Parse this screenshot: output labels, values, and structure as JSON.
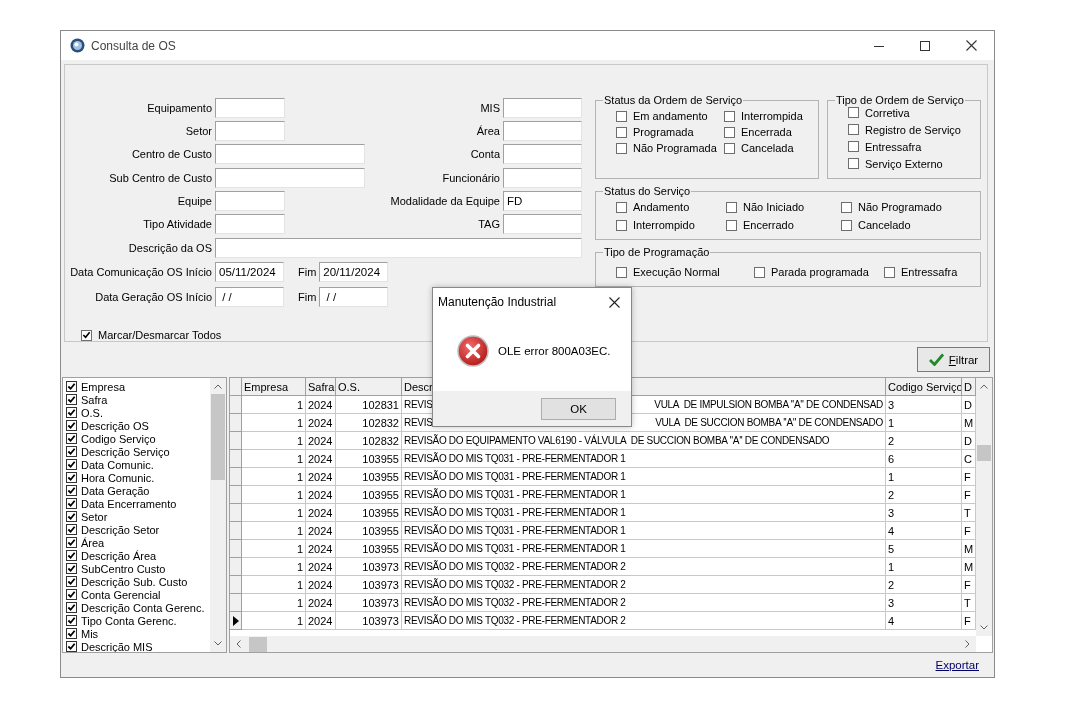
{
  "window": {
    "title": "Consulta de OS"
  },
  "form": {
    "rows": [
      {
        "left": {
          "label": "Equipamento"
        },
        "right": {
          "label": "MIS"
        }
      },
      {
        "left": {
          "label": "Setor"
        },
        "right": {
          "label": "Área"
        }
      },
      {
        "left": {
          "label": "Centro de Custo"
        },
        "right": {
          "label": "Conta"
        }
      },
      {
        "left": {
          "label": "Sub Centro de Custo"
        },
        "right": {
          "label": "Funcionário"
        }
      },
      {
        "left": {
          "label": "Equipe"
        },
        "right": {
          "label": "Modalidade da Equipe",
          "value": "FD"
        }
      },
      {
        "left": {
          "label": "Tipo Atividade"
        },
        "right": {
          "label": "TAG"
        }
      }
    ],
    "description": {
      "label": "Descrição da OS"
    },
    "date_ranges": [
      {
        "label": "Data Comunicação OS Início",
        "start": "05/11/2024",
        "end_label": "Fim",
        "end": "20/11/2024"
      },
      {
        "label": "Data Geração OS Início",
        "start": " / /",
        "end_label": "Fim",
        "end": " / /"
      }
    ],
    "toggle_all": {
      "label": "Marcar/Desmarcar Todos",
      "checked": true
    }
  },
  "groups": [
    {
      "title": "Status da Ordem de Serviço",
      "options": [
        {
          "label": "Em andamento",
          "checked": false
        },
        {
          "label": "Programada",
          "checked": false
        },
        {
          "label": "Não Programada",
          "checked": false
        },
        {
          "label": "Interrompida",
          "checked": false
        },
        {
          "label": "Encerrada",
          "checked": false
        },
        {
          "label": "Cancelada",
          "checked": false
        }
      ]
    },
    {
      "title": "Tipo de Ordem de Serviço",
      "options": [
        {
          "label": "Corretiva",
          "checked": false
        },
        {
          "label": "Registro de Serviço",
          "checked": false
        },
        {
          "label": "Entressafra",
          "checked": false
        },
        {
          "label": "Serviço Externo",
          "checked": false
        }
      ]
    },
    {
      "title": "Status do Serviço",
      "options": [
        {
          "label": "Andamento",
          "checked": false
        },
        {
          "label": "Não Iniciado",
          "checked": false
        },
        {
          "label": "Não Programado",
          "checked": false
        },
        {
          "label": "Interrompido",
          "checked": false
        },
        {
          "label": "Encerrado",
          "checked": false
        },
        {
          "label": "Cancelado",
          "checked": false
        }
      ]
    },
    {
      "title": "Tipo de Programação",
      "options": [
        {
          "label": "Execução Normal",
          "checked": false
        },
        {
          "label": "Parada programada",
          "checked": false
        },
        {
          "label": "Entressafra",
          "checked": false
        }
      ]
    }
  ],
  "filter_button": {
    "label": "Filtrar"
  },
  "column_list": {
    "items": [
      {
        "label": "Empresa",
        "checked": true
      },
      {
        "label": "Safra",
        "checked": true
      },
      {
        "label": "O.S.",
        "checked": true
      },
      {
        "label": "Descrição OS",
        "checked": true
      },
      {
        "label": "Codigo Serviço",
        "checked": true
      },
      {
        "label": "Descrição Serviço",
        "checked": true
      },
      {
        "label": "Data Comunic.",
        "checked": true
      },
      {
        "label": "Hora Comunic.",
        "checked": true
      },
      {
        "label": "Data Geração",
        "checked": true
      },
      {
        "label": "Data Encerramento",
        "checked": true
      },
      {
        "label": "Setor",
        "checked": true
      },
      {
        "label": "Descrição Setor",
        "checked": true
      },
      {
        "label": "Área",
        "checked": true
      },
      {
        "label": "Descrição Área",
        "checked": true
      },
      {
        "label": "SubCentro Custo",
        "checked": true
      },
      {
        "label": "Descrição Sub. Custo",
        "checked": true
      },
      {
        "label": "Conta Gerencial",
        "checked": true
      },
      {
        "label": "Descrição Conta Gerenc.",
        "checked": true
      },
      {
        "label": "Tipo Conta Gerenc.",
        "checked": true
      },
      {
        "label": "Mis",
        "checked": true
      },
      {
        "label": "Descrição MIS",
        "checked": true
      }
    ]
  },
  "grid": {
    "columns": [
      "Empresa",
      "Safra",
      "O.S.",
      "Descr",
      "Codigo Serviço",
      "D"
    ],
    "rows": [
      {
        "selected": false,
        "cells": [
          "1",
          "2024",
          "102831",
          [
            "REVIS",
            "VULA  DE IMPULSION BOMBA ''A'' DE CONDENSAD"
          ],
          "3",
          "D"
        ]
      },
      {
        "selected": false,
        "cells": [
          "1",
          "2024",
          "102832",
          [
            "REVIS",
            "VULA  DE SUCCION BOMBA ''A'' DE CONDENSADO"
          ],
          "1",
          "M"
        ]
      },
      {
        "selected": false,
        "cells": [
          "1",
          "2024",
          "102832",
          "REVISÃO DO EQUIPAMENTO VAL6190 - VÁLVULA  DE SUCCION BOMBA ''A'' DE CONDENSADO",
          "2",
          "D"
        ]
      },
      {
        "selected": false,
        "cells": [
          "1",
          "2024",
          "103955",
          "REVISÃO DO MIS TQ031 - PRE-FERMENTADOR 1",
          "6",
          "C"
        ]
      },
      {
        "selected": false,
        "cells": [
          "1",
          "2024",
          "103955",
          "REVISÃO DO MIS TQ031 - PRE-FERMENTADOR 1",
          "1",
          "F"
        ]
      },
      {
        "selected": false,
        "cells": [
          "1",
          "2024",
          "103955",
          "REVISÃO DO MIS TQ031 - PRE-FERMENTADOR 1",
          "2",
          "F"
        ]
      },
      {
        "selected": false,
        "cells": [
          "1",
          "2024",
          "103955",
          "REVISÃO DO MIS TQ031 - PRE-FERMENTADOR 1",
          "3",
          "T"
        ]
      },
      {
        "selected": false,
        "cells": [
          "1",
          "2024",
          "103955",
          "REVISÃO DO MIS TQ031 - PRE-FERMENTADOR 1",
          "4",
          "F"
        ]
      },
      {
        "selected": false,
        "cells": [
          "1",
          "2024",
          "103955",
          "REVISÃO DO MIS TQ031 - PRE-FERMENTADOR 1",
          "5",
          "M"
        ]
      },
      {
        "selected": false,
        "cells": [
          "1",
          "2024",
          "103973",
          "REVISÃO DO MIS TQ032 - PRE-FERMENTADOR 2",
          "1",
          "M"
        ]
      },
      {
        "selected": false,
        "cells": [
          "1",
          "2024",
          "103973",
          "REVISÃO DO MIS TQ032 - PRE-FERMENTADOR 2",
          "2",
          "F"
        ]
      },
      {
        "selected": false,
        "cells": [
          "1",
          "2024",
          "103973",
          "REVISÃO DO MIS TQ032 - PRE-FERMENTADOR 2",
          "3",
          "T"
        ]
      },
      {
        "selected": true,
        "cells": [
          "1",
          "2024",
          "103973",
          "REVISÃO DO MIS TQ032 - PRE-FERMENTADOR 2",
          "4",
          "F"
        ]
      }
    ]
  },
  "export_link": "Exportar",
  "dialog": {
    "title": "Manutenção Industrial",
    "message": "OLE error 800A03EC.",
    "button": "OK"
  }
}
